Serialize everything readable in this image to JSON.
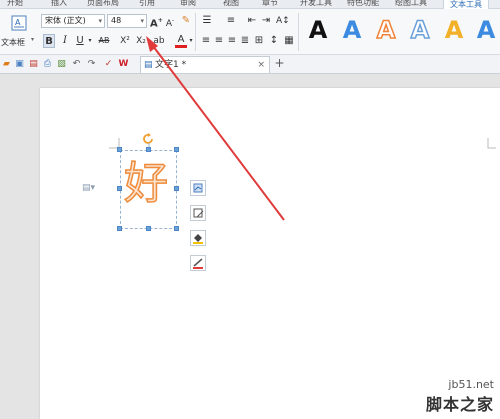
{
  "tabs": [
    "开始",
    "插入",
    "页面布局",
    "引用",
    "审阅",
    "视图",
    "章节",
    "开发工具",
    "特色功能",
    "绘图工具",
    "文本工具"
  ],
  "active_tab": "文本工具",
  "ribbon": {
    "textbox_label": "文本框",
    "font_name": "宋体 (正文)",
    "font_size": "48",
    "bold": "B",
    "italic": "I",
    "underline": "U",
    "strike": "AB",
    "superscript": "X²",
    "subscript": "X₂",
    "grow_font": "A",
    "shrink_font": "A",
    "font_color": "A",
    "text_style_samples": [
      "A",
      "A",
      "A",
      "A",
      "A",
      "A"
    ]
  },
  "document_tab": "文字1 *",
  "page": {
    "char": "好"
  },
  "watermark": {
    "site": "jb51.net",
    "brand": "脚本之家"
  },
  "colors": {
    "ribbon_bg": "#f7f8fa",
    "accent": "#2f6db5",
    "orange": "#f4a05a",
    "arrow": "#e03a3a"
  }
}
